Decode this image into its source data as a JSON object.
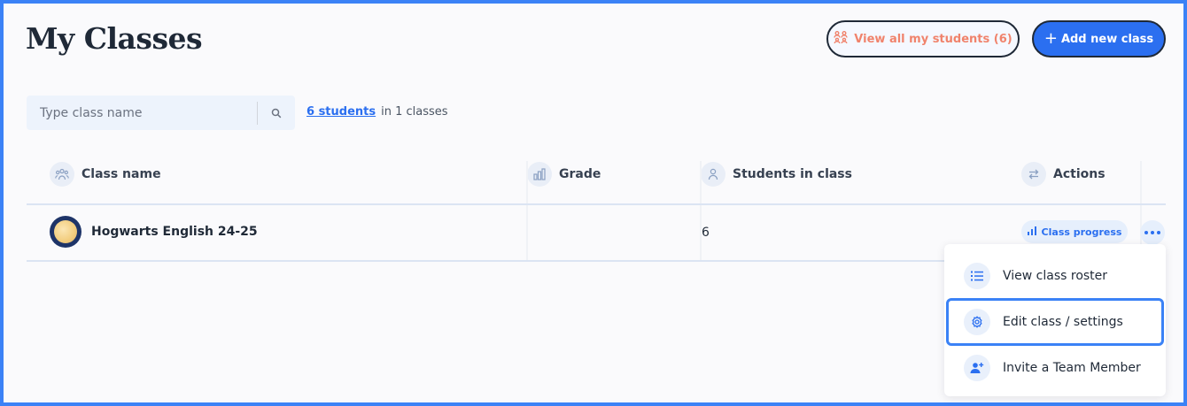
{
  "header": {
    "title": "My Classes",
    "view_students_label": "View all my students (6)",
    "add_class_label": "Add new class"
  },
  "search": {
    "placeholder": "Type class name",
    "value": ""
  },
  "summary": {
    "students_link": "6 students",
    "classes_text": "in 1 classes"
  },
  "table": {
    "columns": [
      "Class name",
      "Grade",
      "Students in class",
      "Actions"
    ],
    "rows": [
      {
        "class_name": "Hogwarts English 24-25",
        "grade": "",
        "students": "6",
        "progress_label": "Class progress"
      }
    ]
  },
  "menu": {
    "items": [
      {
        "label": "View class roster",
        "icon": "list-icon"
      },
      {
        "label": "Edit class / settings",
        "icon": "gear-icon"
      },
      {
        "label": "Invite a Team Member",
        "icon": "add-user-icon"
      }
    ],
    "highlighted_index": 1
  },
  "colors": {
    "accent": "#2b6ff0",
    "outline_text": "#f0836c",
    "focus_border": "#3b82f6"
  }
}
